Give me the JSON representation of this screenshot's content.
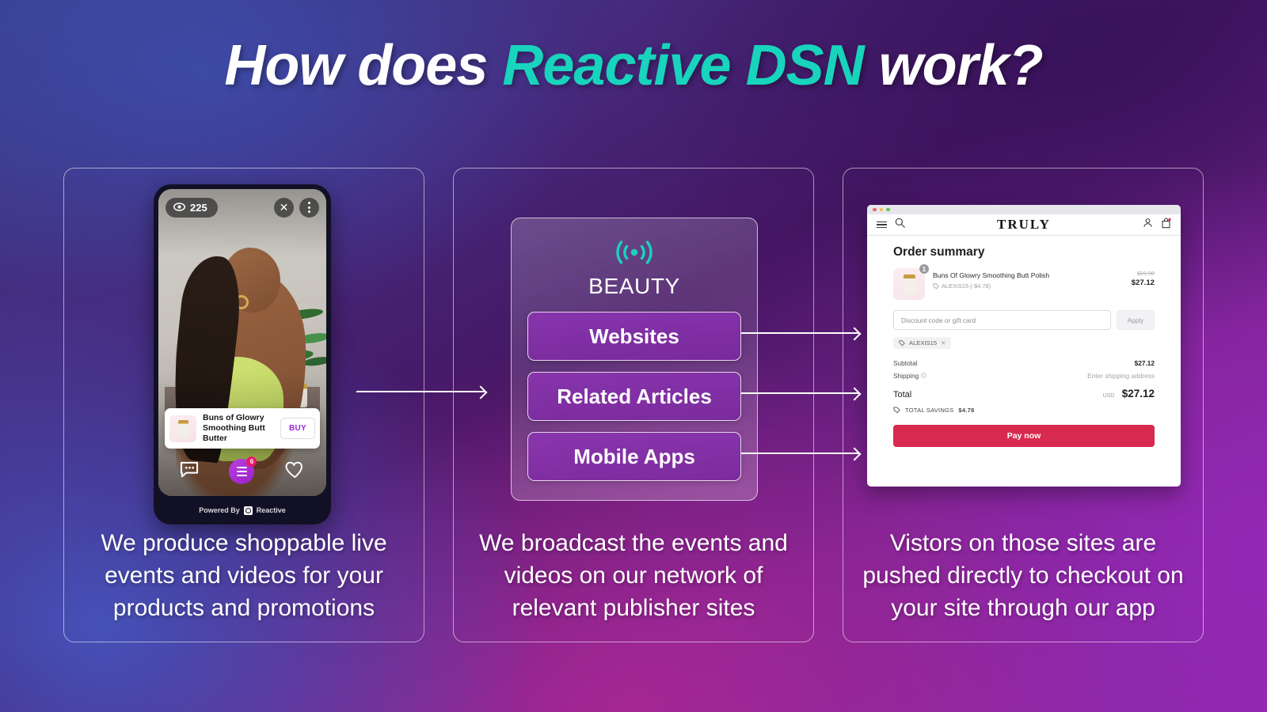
{
  "title": {
    "part1": "How does ",
    "accent": "Reactive DSN",
    "part2": " work?"
  },
  "colors": {
    "accent": "#18d4bd",
    "pay_button": "#d82a4f",
    "fab": "#9a22c9",
    "badge": "#e81a6b"
  },
  "panels": [
    {
      "id": "produce",
      "caption": "We produce shoppable live events and videos for your products and promotions"
    },
    {
      "id": "broadcast",
      "caption": "We broadcast the events and videos on our network of relevant publisher sites"
    },
    {
      "id": "checkout",
      "caption": "Vistors on those sites are pushed directly to checkout on your site through our app"
    }
  ],
  "phone": {
    "view_count": "225",
    "close_icon": "✕",
    "menu_icon": "kebab-menu",
    "eye_icon": "eye",
    "product_name": "Buns of Glowry Smoothing Butt Butter",
    "buy_label": "BUY",
    "cart_badge": "6",
    "powered_by": "Powered By",
    "brand": "Reactive"
  },
  "network": {
    "broadcast_icon": "broadcast-waves",
    "category": "BEAUTY",
    "channels": [
      {
        "label": "Websites"
      },
      {
        "label": "Related Articles"
      },
      {
        "label": "Mobile Apps"
      }
    ]
  },
  "checkout": {
    "brand": "TRULY",
    "menu_icon": "hamburger",
    "search_icon": "search",
    "account_icon": "user",
    "bag_icon": "shopping-bag",
    "title": "Order summary",
    "item": {
      "name": "Buns Of Glowry Smoothing Butt Polish",
      "discount_note": "ALEXIS15 (-$4.78)",
      "qty": "1",
      "price_was": "$31.90",
      "price_now": "$27.12"
    },
    "discount_placeholder": "Discount code or gift card",
    "apply_label": "Apply",
    "applied_code": "ALEXIS15",
    "remove_icon": "✕",
    "subtotal_label": "Subtotal",
    "subtotal_value": "$27.12",
    "shipping_label": "Shipping",
    "shipping_info_icon": "info",
    "shipping_value": "Enter shipping address",
    "total_label": "Total",
    "total_currency": "USD",
    "total_value": "$27.12",
    "savings_label": "TOTAL SAVINGS",
    "savings_value": "$4.78",
    "pay_label": "Pay now"
  }
}
